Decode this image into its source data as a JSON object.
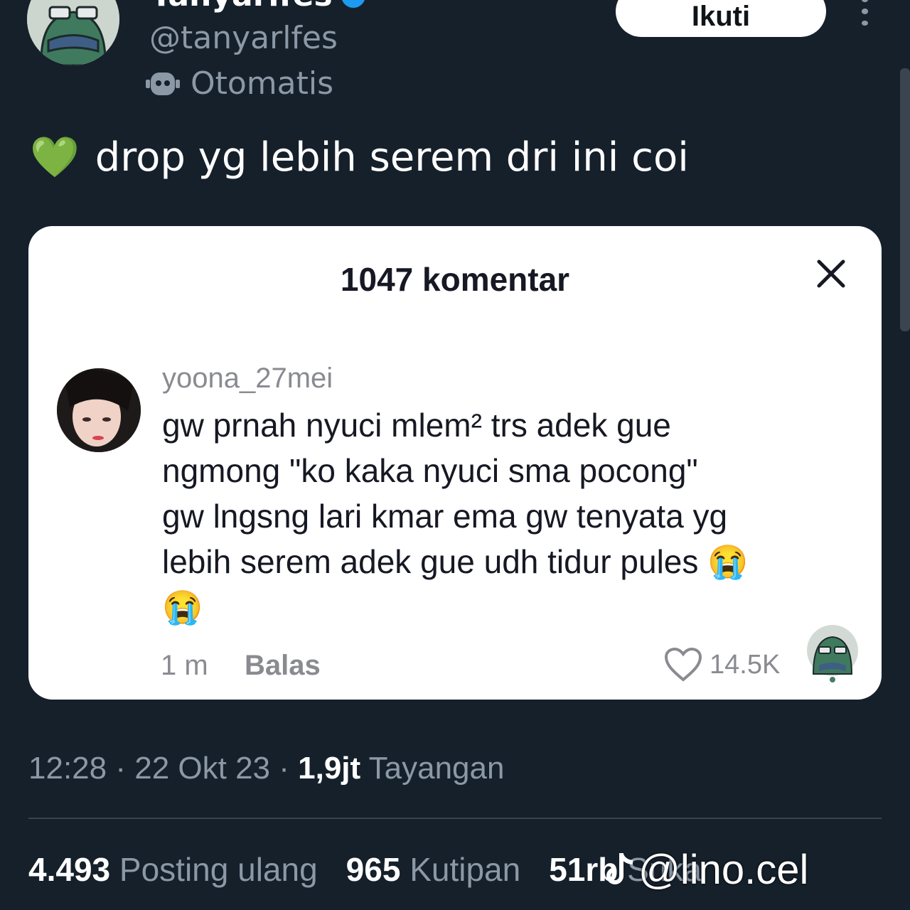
{
  "author": {
    "display_name": "Tanyarlfes",
    "handle": "@tanyarlfes",
    "automated_label": "Otomatis",
    "avatar_icon": "sad-frog-avatar",
    "verified_color": "#1d9bf0"
  },
  "header": {
    "follow_label": "Ikuti",
    "more_icon": "more-vertical-icon"
  },
  "tweet": {
    "emoji": "💚",
    "text": "drop yg lebih serem dri ini coi"
  },
  "embedded_card": {
    "title": "1047 komentar",
    "close_icon": "close-icon",
    "comment": {
      "username": "yoona_27mei",
      "text": "gw prnah nyuci mlem² trs adek gue\nngmong \"ko kaka nyuci sma pocong\"\ngw lngsng lari kmar ema gw tenyata yg\nlebih serem adek gue udh tidur pules 😭\n😭",
      "time": "1 m",
      "reply_label": "Balas",
      "likes": "14.5K"
    }
  },
  "meta": {
    "time": "12:28",
    "date": "22 Okt 23",
    "views_count": "1,9jt",
    "views_label": "Tayangan"
  },
  "stats": {
    "reposts_count": "4.493",
    "reposts_label": "Posting ulang",
    "quotes_count": "965",
    "quotes_label": "Kutipan",
    "likes_count": "51rb",
    "likes_label": "Suka"
  },
  "watermark": {
    "text": "@lino.cel",
    "icon": "tiktok-icon"
  },
  "colors": {
    "background": "#15202b",
    "card": "#ffffff",
    "muted": "#8b98a5"
  }
}
